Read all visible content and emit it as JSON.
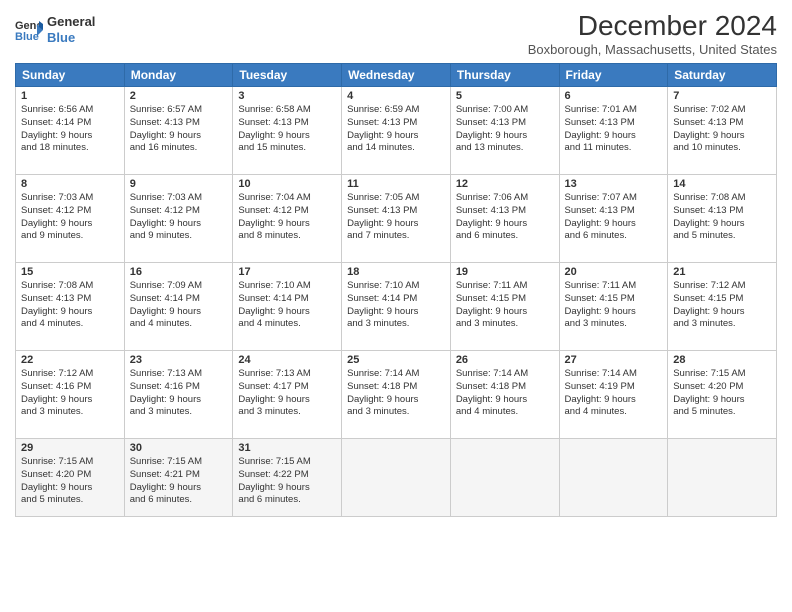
{
  "logo": {
    "line1": "General",
    "line2": "Blue"
  },
  "title": "December 2024",
  "location": "Boxborough, Massachusetts, United States",
  "days_header": [
    "Sunday",
    "Monday",
    "Tuesday",
    "Wednesday",
    "Thursday",
    "Friday",
    "Saturday"
  ],
  "weeks": [
    [
      {
        "num": "1",
        "rise": "6:56 AM",
        "set": "4:14 PM",
        "hours": "9 hours and 18 minutes."
      },
      {
        "num": "2",
        "rise": "6:57 AM",
        "set": "4:13 PM",
        "hours": "9 hours and 16 minutes."
      },
      {
        "num": "3",
        "rise": "6:58 AM",
        "set": "4:13 PM",
        "hours": "9 hours and 15 minutes."
      },
      {
        "num": "4",
        "rise": "6:59 AM",
        "set": "4:13 PM",
        "hours": "9 hours and 14 minutes."
      },
      {
        "num": "5",
        "rise": "7:00 AM",
        "set": "4:13 PM",
        "hours": "9 hours and 13 minutes."
      },
      {
        "num": "6",
        "rise": "7:01 AM",
        "set": "4:13 PM",
        "hours": "9 hours and 11 minutes."
      },
      {
        "num": "7",
        "rise": "7:02 AM",
        "set": "4:13 PM",
        "hours": "9 hours and 10 minutes."
      }
    ],
    [
      {
        "num": "8",
        "rise": "7:03 AM",
        "set": "4:12 PM",
        "hours": "9 hours and 9 minutes."
      },
      {
        "num": "9",
        "rise": "7:03 AM",
        "set": "4:12 PM",
        "hours": "9 hours and 9 minutes."
      },
      {
        "num": "10",
        "rise": "7:04 AM",
        "set": "4:12 PM",
        "hours": "9 hours and 8 minutes."
      },
      {
        "num": "11",
        "rise": "7:05 AM",
        "set": "4:13 PM",
        "hours": "9 hours and 7 minutes."
      },
      {
        "num": "12",
        "rise": "7:06 AM",
        "set": "4:13 PM",
        "hours": "9 hours and 6 minutes."
      },
      {
        "num": "13",
        "rise": "7:07 AM",
        "set": "4:13 PM",
        "hours": "9 hours and 6 minutes."
      },
      {
        "num": "14",
        "rise": "7:08 AM",
        "set": "4:13 PM",
        "hours": "9 hours and 5 minutes."
      }
    ],
    [
      {
        "num": "15",
        "rise": "7:08 AM",
        "set": "4:13 PM",
        "hours": "9 hours and 4 minutes."
      },
      {
        "num": "16",
        "rise": "7:09 AM",
        "set": "4:14 PM",
        "hours": "9 hours and 4 minutes."
      },
      {
        "num": "17",
        "rise": "7:10 AM",
        "set": "4:14 PM",
        "hours": "9 hours and 4 minutes."
      },
      {
        "num": "18",
        "rise": "7:10 AM",
        "set": "4:14 PM",
        "hours": "9 hours and 3 minutes."
      },
      {
        "num": "19",
        "rise": "7:11 AM",
        "set": "4:15 PM",
        "hours": "9 hours and 3 minutes."
      },
      {
        "num": "20",
        "rise": "7:11 AM",
        "set": "4:15 PM",
        "hours": "9 hours and 3 minutes."
      },
      {
        "num": "21",
        "rise": "7:12 AM",
        "set": "4:15 PM",
        "hours": "9 hours and 3 minutes."
      }
    ],
    [
      {
        "num": "22",
        "rise": "7:12 AM",
        "set": "4:16 PM",
        "hours": "9 hours and 3 minutes."
      },
      {
        "num": "23",
        "rise": "7:13 AM",
        "set": "4:16 PM",
        "hours": "9 hours and 3 minutes."
      },
      {
        "num": "24",
        "rise": "7:13 AM",
        "set": "4:17 PM",
        "hours": "9 hours and 3 minutes."
      },
      {
        "num": "25",
        "rise": "7:14 AM",
        "set": "4:18 PM",
        "hours": "9 hours and 3 minutes."
      },
      {
        "num": "26",
        "rise": "7:14 AM",
        "set": "4:18 PM",
        "hours": "9 hours and 4 minutes."
      },
      {
        "num": "27",
        "rise": "7:14 AM",
        "set": "4:19 PM",
        "hours": "9 hours and 4 minutes."
      },
      {
        "num": "28",
        "rise": "7:15 AM",
        "set": "4:20 PM",
        "hours": "9 hours and 5 minutes."
      }
    ],
    [
      {
        "num": "29",
        "rise": "7:15 AM",
        "set": "4:20 PM",
        "hours": "9 hours and 5 minutes."
      },
      {
        "num": "30",
        "rise": "7:15 AM",
        "set": "4:21 PM",
        "hours": "9 hours and 6 minutes."
      },
      {
        "num": "31",
        "rise": "7:15 AM",
        "set": "4:22 PM",
        "hours": "9 hours and 6 minutes."
      },
      null,
      null,
      null,
      null
    ]
  ],
  "labels": {
    "sunrise": "Sunrise:",
    "sunset": "Sunset:",
    "daylight": "Daylight:"
  }
}
